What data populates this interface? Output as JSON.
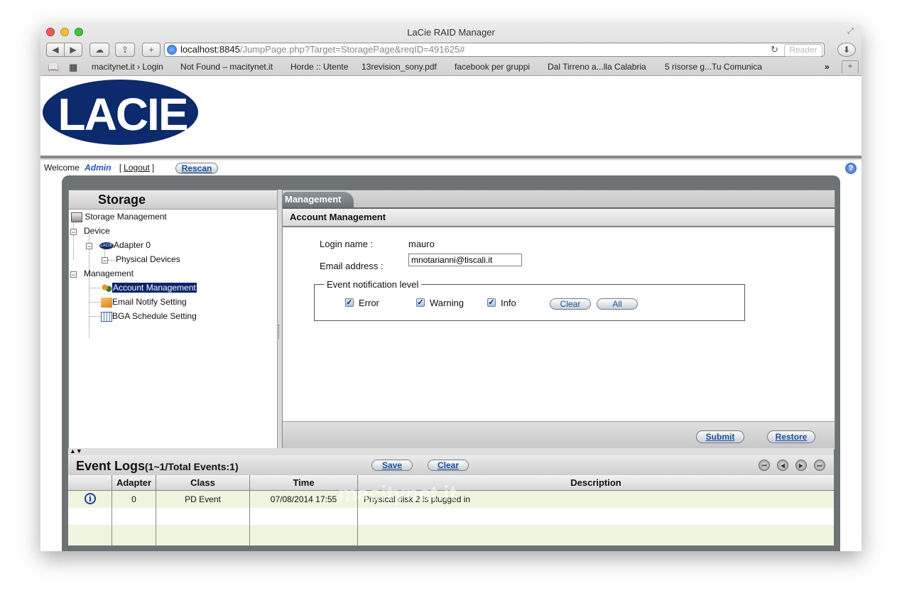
{
  "browser": {
    "window_title": "LaCie RAID Manager",
    "url_host": "localhost:8845",
    "url_path": "/JumpPage.php?Target=StoragePage&reqID=491625#",
    "reader_label": "Reader",
    "bookmarks": [
      "macitynet.it › Login",
      "Not Found – macitynet.it",
      "Horde :: Utente",
      "13revision_sony.pdf",
      "facebook per gruppi",
      "Dal Tirreno a...lla Calabria",
      "5 risorse g...Tu Comunica"
    ],
    "colors": {
      "close": "#ee5b4f",
      "minimize": "#f4bf3b",
      "zoom": "#3ec244"
    }
  },
  "logo": {
    "text": "LACIE",
    "color": "#0d2a6c"
  },
  "header": {
    "welcome": "Welcome",
    "user": "Admin",
    "logout": "Logout",
    "rescan": "Rescan"
  },
  "left_panel": {
    "title": "Storage",
    "tree": {
      "storage_management": "Storage Management",
      "device": "Device",
      "adapter": "Adapter 0",
      "adapter_badge": "LACIE",
      "physical_devices": "Physical Devices",
      "management": "Management",
      "account_management": "Account Management",
      "email_notify": "Email Notify Setting",
      "bga_schedule": "BGA Schedule Setting"
    }
  },
  "right_panel": {
    "tab": "Management",
    "section_title": "Account Management",
    "login_label": "Login name :",
    "login_value": "mauro",
    "email_label": "Email address :",
    "email_value": "mnotarianni@tiscali.it",
    "notification_legend": "Event notification level",
    "checks": [
      {
        "label": "Error",
        "checked": true
      },
      {
        "label": "Warning",
        "checked": true
      },
      {
        "label": "Info",
        "checked": true
      }
    ],
    "clear_btn": "Clear",
    "all_btn": "All",
    "submit_btn": "Submit",
    "restore_btn": "Restore"
  },
  "event_logs": {
    "title": "Event Logs",
    "range": "(1~1/Total Events:1)",
    "save_btn": "Save",
    "clear_btn": "Clear",
    "columns": [
      "Adapter",
      "Class",
      "Time",
      "Description"
    ],
    "rows": [
      {
        "icon": "info-icon",
        "adapter": "0",
        "class": "PD Event",
        "time": "07/08/2014 17:55",
        "description": "Physical disk 2 is plugged in"
      }
    ]
  },
  "watermark": "macitynet.it"
}
